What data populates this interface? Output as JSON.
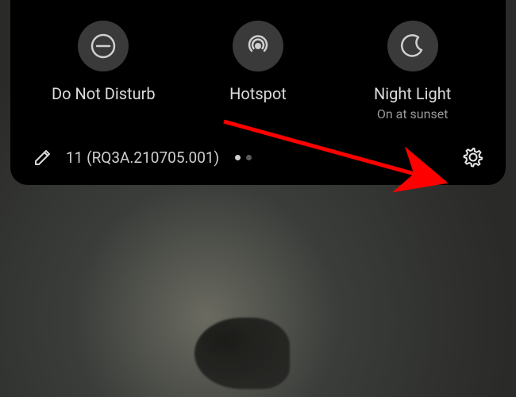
{
  "tiles": [
    {
      "name": "do-not-disturb",
      "label": "Do Not Disturb",
      "sublabel": ""
    },
    {
      "name": "hotspot",
      "label": "Hotspot",
      "sublabel": ""
    },
    {
      "name": "night-light",
      "label": "Night Light",
      "sublabel": "On at sunset"
    }
  ],
  "version_text": "11 (RQ3A.210705.001)",
  "pagination": {
    "count": 2,
    "active": 0
  }
}
